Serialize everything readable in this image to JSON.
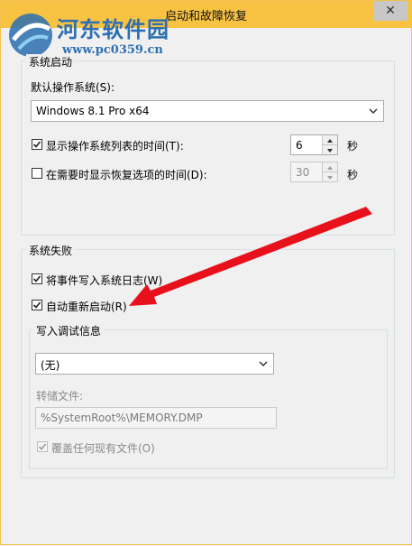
{
  "window": {
    "title": "启动和故障恢复",
    "close_glyph": "✕"
  },
  "watermark": {
    "title": "河东软件园",
    "url": "www.pc0359.cn"
  },
  "system_startup": {
    "legend": "系统启动",
    "default_os_label": "默认操作系统(S):",
    "default_os_value": "Windows 8.1 Pro x64",
    "show_os_list": {
      "label": "显示操作系统列表的时间(T):",
      "checked": true,
      "value": "6",
      "unit": "秒"
    },
    "show_recovery": {
      "label": "在需要时显示恢复选项的时间(D):",
      "checked": false,
      "value": "30",
      "unit": "秒"
    }
  },
  "system_failure": {
    "legend": "系统失败",
    "write_event_log": {
      "label": "将事件写入系统日志(W)",
      "checked": true
    },
    "auto_restart": {
      "label": "自动重新启动(R)",
      "checked": true
    },
    "debug_info": {
      "legend": "写入调试信息",
      "type_value": "(无)",
      "dump_file_label": "转储文件:",
      "dump_file_value": "%SystemRoot%\\MEMORY.DMP",
      "overwrite": {
        "label": "覆盖任何现有文件(O)",
        "checked": true
      }
    }
  },
  "colors": {
    "titlebar": "#f8c243",
    "watermark": "#2c6fb2",
    "arrow": "#e8101a"
  }
}
